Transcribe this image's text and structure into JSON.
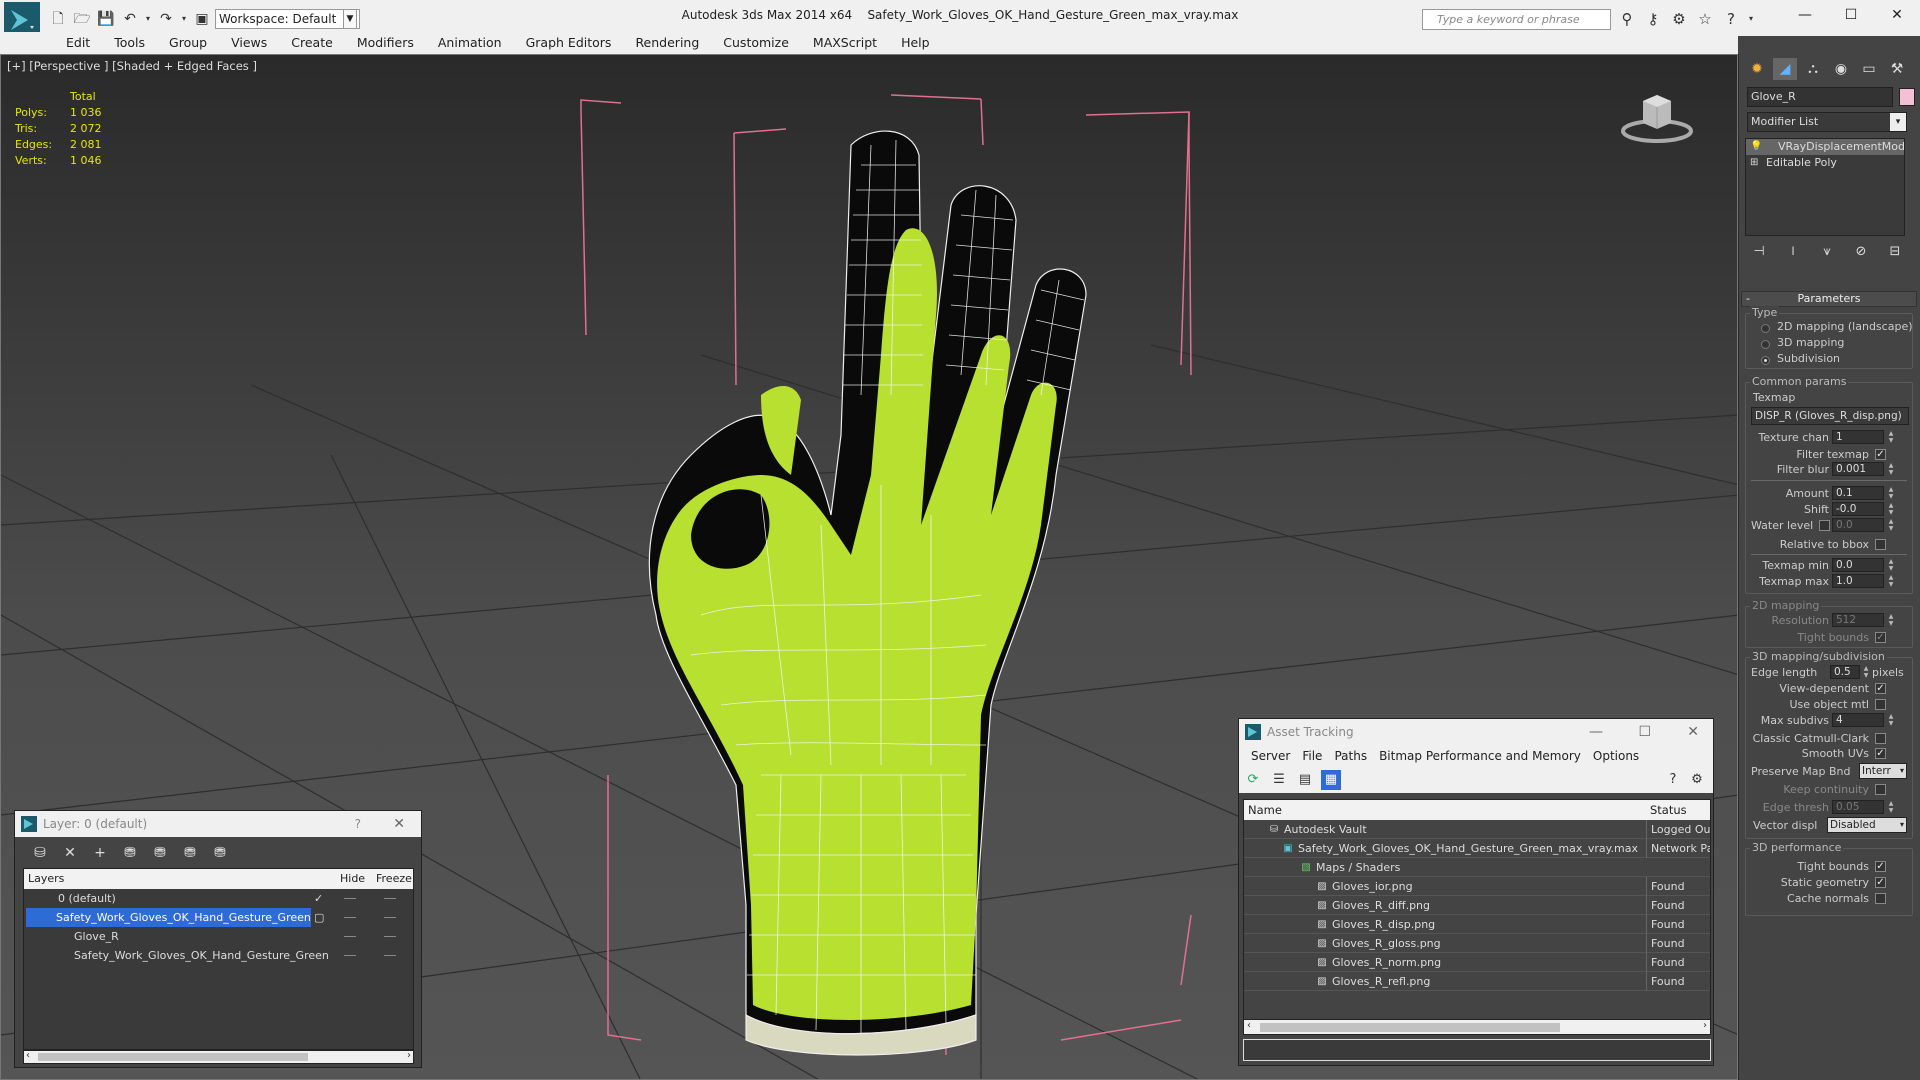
{
  "app": {
    "name": "Autodesk 3ds Max  2014 x64",
    "file": "Safety_Work_Gloves_OK_Hand_Gesture_Green_max_vray.max",
    "workspace": "Workspace: Default",
    "search_placeholder": "Type a keyword or phrase"
  },
  "menu": [
    "Edit",
    "Tools",
    "Group",
    "Views",
    "Create",
    "Modifiers",
    "Animation",
    "Graph Editors",
    "Rendering",
    "Customize",
    "MAXScript",
    "Help"
  ],
  "viewport": {
    "label": "[+] [Perspective ] [Shaded + Edged Faces ]",
    "stats": {
      "total_label": "Total",
      "rows": [
        {
          "k": "Polys:",
          "v": "1 036"
        },
        {
          "k": "Tris:",
          "v": "2 072"
        },
        {
          "k": "Edges:",
          "v": "2 081"
        },
        {
          "k": "Verts:",
          "v": "1 046"
        }
      ]
    }
  },
  "command_panel": {
    "object_name": "Glove_R",
    "object_color": "#f4c1d4",
    "modifier_list": "Modifier List",
    "stack": [
      "VRayDisplacementMod",
      "Editable Poly"
    ],
    "parameters_title": "Parameters",
    "type_group": "Type",
    "type_options": [
      "2D mapping (landscape)",
      "3D mapping",
      "Subdivision"
    ],
    "common_group": "Common params",
    "texmap_label": "Texmap",
    "texmap_value": "DISP_R (Gloves_R_disp.png)",
    "texture_chan_label": "Texture chan",
    "texture_chan": "1",
    "filter_texmap_label": "Filter texmap",
    "filter_blur_label": "Filter blur",
    "filter_blur": "0.001",
    "amount_label": "Amount",
    "amount": "0.1",
    "shift_label": "Shift",
    "shift": "-0.0",
    "water_level_label": "Water level",
    "water_level": "0.0",
    "relative_bbox_label": "Relative to bbox",
    "texmap_min_label": "Texmap min",
    "texmap_min": "0.0",
    "texmap_max_label": "Texmap max",
    "texmap_max": "1.0",
    "mapping2d_group": "2D mapping",
    "resolution_label": "Resolution",
    "resolution": "512",
    "tight_bounds_label": "Tight bounds",
    "mapping3d_group": "3D mapping/subdivision",
    "edge_length_label": "Edge length",
    "edge_length": "0.5",
    "pixels_label": "pixels",
    "view_dependent_label": "View-dependent",
    "use_object_mtl_label": "Use object mtl",
    "max_subdivs_label": "Max subdivs",
    "max_subdivs": "4",
    "classic_catmull_label": "Classic Catmull-Clark",
    "smooth_uvs_label": "Smooth UVs",
    "preserve_map_label": "Preserve Map Bnd",
    "preserve_map_value": "Interr",
    "keep_continuity_label": "Keep continuity",
    "edge_thresh_label": "Edge thresh",
    "edge_thresh": "0.05",
    "vector_displ_label": "Vector displ",
    "vector_displ_value": "Disabled",
    "perf_group": "3D performance",
    "perf_tight_bounds_label": "Tight bounds",
    "static_geometry_label": "Static geometry",
    "cache_normals_label": "Cache normals"
  },
  "layer_window": {
    "title": "Layer: 0 (default)",
    "help": "?",
    "columns": [
      "Layers",
      "Hide",
      "Freeze"
    ],
    "rows": [
      {
        "name": "0 (default)"
      },
      {
        "name": "Safety_Work_Gloves_OK_Hand_Gesture_Green"
      },
      {
        "name": "Glove_R"
      },
      {
        "name": "Safety_Work_Gloves_OK_Hand_Gesture_Green"
      }
    ]
  },
  "asset_window": {
    "title": "Asset Tracking",
    "menu": [
      "Server",
      "File",
      "Paths",
      "Bitmap Performance and Memory",
      "Options"
    ],
    "columns": [
      "Name",
      "Status"
    ],
    "rows": [
      {
        "name": "Autodesk Vault",
        "status": "Logged Out"
      },
      {
        "name": "Safety_Work_Gloves_OK_Hand_Gesture_Green_max_vray.max",
        "status": "Network Pa"
      },
      {
        "name": "Maps / Shaders",
        "status": ""
      },
      {
        "name": "Gloves_ior.png",
        "status": "Found"
      },
      {
        "name": "Gloves_R_diff.png",
        "status": "Found"
      },
      {
        "name": "Gloves_R_disp.png",
        "status": "Found"
      },
      {
        "name": "Gloves_R_gloss.png",
        "status": "Found"
      },
      {
        "name": "Gloves_R_norm.png",
        "status": "Found"
      },
      {
        "name": "Gloves_R_refl.png",
        "status": "Found"
      }
    ]
  },
  "colors": {
    "glove": "#b8e030",
    "bbox": "#e07090",
    "selection": "#2d6bd6",
    "stats": "#e6e600"
  }
}
